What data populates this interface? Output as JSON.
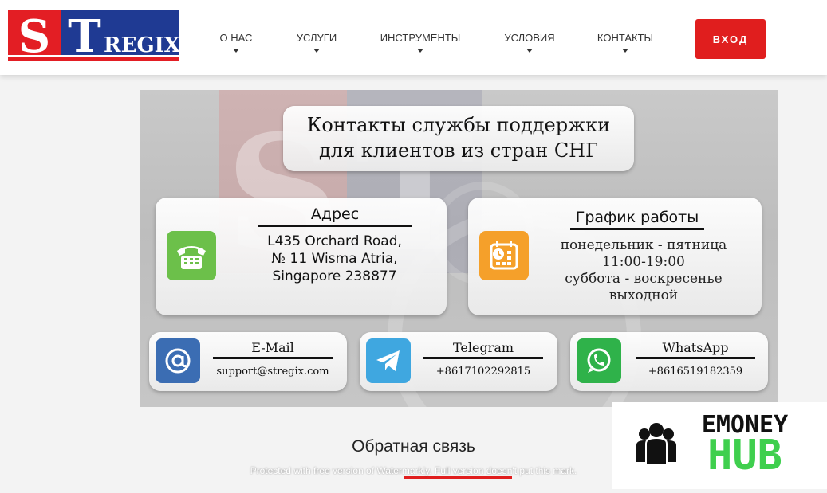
{
  "brand": {
    "logo_letters": "ST",
    "logo_word": "REGIX",
    "colors": {
      "red": "#e31e24",
      "blue": "#1f3a93",
      "accent": "#e01e1e"
    }
  },
  "nav": {
    "items": [
      {
        "label": "О НАС"
      },
      {
        "label": "УСЛУГИ"
      },
      {
        "label": "ИНСТРУМЕНТЫ"
      },
      {
        "label": "УСЛОВИЯ"
      },
      {
        "label": "КОНТАКТЫ"
      }
    ],
    "login_label": "ВХОД"
  },
  "banner": {
    "title_line1": "Контакты службы поддержки",
    "title_line2": "для клиентов из стран СНГ",
    "address": {
      "title": "Адрес",
      "line1": "L435 Orchard Road,",
      "line2": "№ 11 Wisma Atria,",
      "line3": "Singapore 238877",
      "icon": "telephone-icon"
    },
    "schedule": {
      "title": "График работы",
      "line1": "понедельник - пятница",
      "line2": "11:00-19:00",
      "line3": "суббота - воскресенье",
      "line4": "выходной",
      "icon": "calendar-clock-icon"
    },
    "email": {
      "title": "E-Mail",
      "value": "support@stregix.com",
      "icon": "at-icon"
    },
    "telegram": {
      "title": "Telegram",
      "value": "+8617102292815",
      "icon": "telegram-icon"
    },
    "whatsapp": {
      "title": "WhatsApp",
      "value": "+8616519182359",
      "icon": "whatsapp-icon"
    }
  },
  "feedback": {
    "title": "Обратная связь"
  },
  "overlay": {
    "watermark_text": "Protected with free version of Watermarkly. Full version doesn't put this mark.",
    "emoney_word1": "EMONEY",
    "emoney_word2": "HUB",
    "emoney_color": "#3fcf4e"
  }
}
